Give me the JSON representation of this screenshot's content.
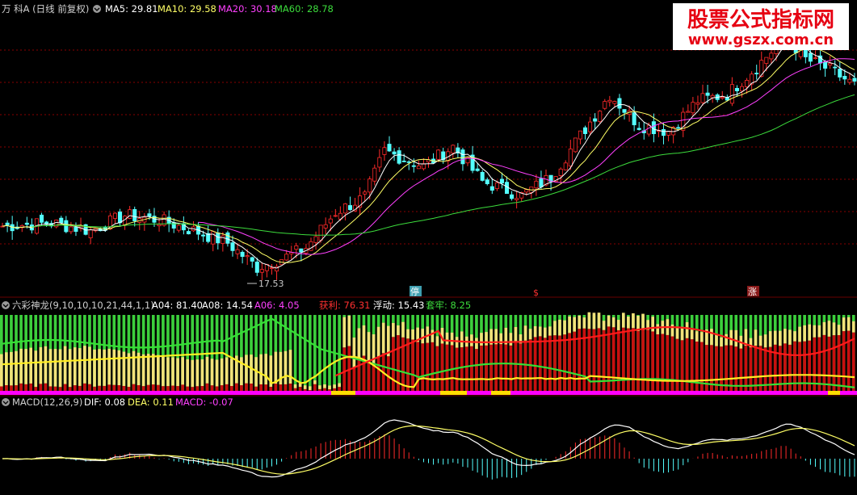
{
  "colors": {
    "bg": "#000000",
    "up": "#ff2a2a",
    "down": "#54ffff",
    "ma5": "#ffffff",
    "ma10": "#ffff66",
    "ma20": "#ff40ff",
    "ma60": "#3cdc3c",
    "grid": "#8a0000",
    "green_fill": "#3ccf3c",
    "yellow_fill": "#f2e27a",
    "red_fill": "#c80f0f",
    "magenta": "#ff00ff"
  },
  "main": {
    "title": "万 科A (日线 前复权)",
    "ma5": "MA5: 29.81",
    "ma10": "MA10: 29.58",
    "ma20": "MA20: 30.18",
    "ma60": "MA60: 28.78",
    "low_label": "17.53",
    "marker_ting": "停",
    "marker_dollar": "$",
    "marker_zhang": "涨"
  },
  "watermark": {
    "title": "股票公式指标网",
    "url": "www.gszx.com.cn"
  },
  "indicator": {
    "title": "六彩神龙(9,10,10,10,21,44,1,1)",
    "a04": "A04: 81.40",
    "a08": "A08: 14.54",
    "a06": "A06: 4.05",
    "huoli": "获利: 76.31",
    "fudong": "浮动: 15.43",
    "taolao": "套牢: 8.25"
  },
  "macd": {
    "title": "MACD(12,26,9)",
    "dif": "DIF: 0.08",
    "dea": "DEA: 0.11",
    "macd": "MACD: -0.07"
  },
  "chart_data": {
    "type": "line",
    "price_anchors": [
      [
        0,
        20.6
      ],
      [
        10,
        20.8
      ],
      [
        18,
        20.3
      ],
      [
        25,
        21.3
      ],
      [
        32,
        21.0
      ],
      [
        40,
        20.2
      ],
      [
        46,
        19.5
      ],
      [
        52,
        17.9
      ],
      [
        58,
        18.6
      ],
      [
        62,
        19.2
      ],
      [
        68,
        21.5
      ],
      [
        74,
        22.5
      ],
      [
        78,
        25.5
      ],
      [
        86,
        24.5
      ],
      [
        92,
        25.8
      ],
      [
        98,
        23.5
      ],
      [
        106,
        22.6
      ],
      [
        112,
        23.8
      ],
      [
        118,
        26.5
      ],
      [
        124,
        29.2
      ],
      [
        130,
        27.2
      ],
      [
        136,
        26.8
      ],
      [
        142,
        28.8
      ],
      [
        148,
        29.2
      ],
      [
        154,
        31.0
      ],
      [
        160,
        33.0
      ],
      [
        164,
        31.5
      ],
      [
        169,
        30.8
      ],
      [
        174,
        29.8
      ]
    ],
    "bars": 175,
    "low_value": 17.53
  }
}
